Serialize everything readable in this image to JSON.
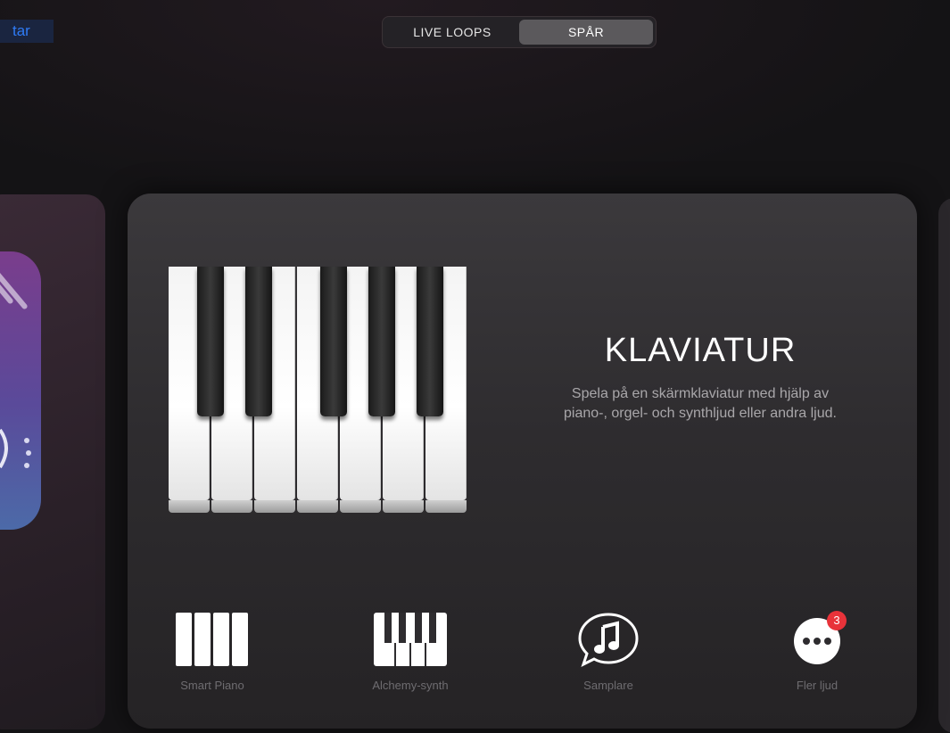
{
  "nav": {
    "back_label": "tar"
  },
  "segmented": {
    "options": [
      "LIVE LOOPS",
      "SPÅR"
    ],
    "selected": "SPÅR"
  },
  "card": {
    "title": "KLAVIATUR",
    "description_line1": "Spela på en skärmklaviatur med hjälp av",
    "description_line2": "piano-, orgel- och synthljud eller andra ljud."
  },
  "bottom_items": [
    {
      "label": "Smart Piano",
      "icon": "smart-piano-icon"
    },
    {
      "label": "Alchemy-synth",
      "icon": "alchemy-keyboard-icon"
    },
    {
      "label": "Samplare",
      "icon": "sampler-note-icon"
    },
    {
      "label": "Fler ljud",
      "icon": "more-icon",
      "badge": "3"
    }
  ],
  "colors": {
    "accent": "#2f7bf5",
    "badge": "#e8333a",
    "background": "#141315"
  }
}
